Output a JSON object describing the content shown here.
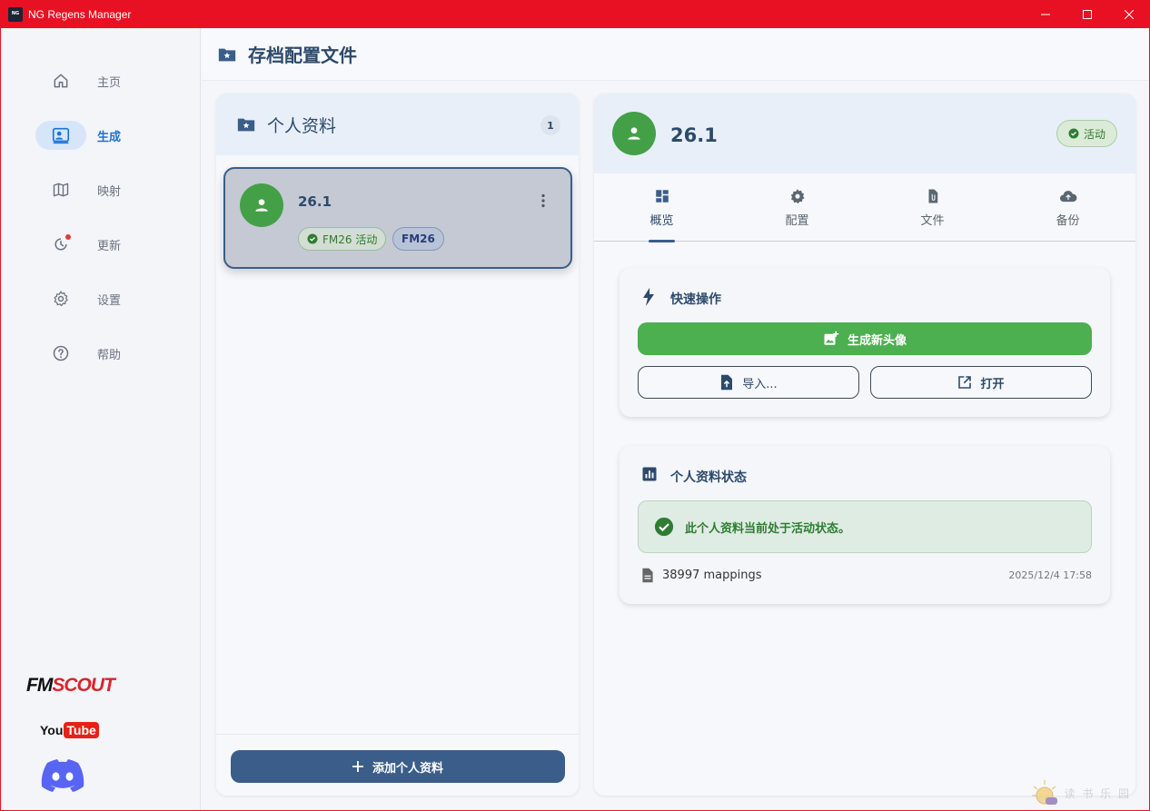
{
  "window": {
    "logo_text": "NG",
    "title": "NG Regens Manager"
  },
  "sidebar": {
    "items": [
      {
        "label": "主页",
        "icon": "home-icon",
        "active": false
      },
      {
        "label": "生成",
        "icon": "account-box-icon",
        "active": true
      },
      {
        "label": "映射",
        "icon": "map-icon",
        "active": false
      },
      {
        "label": "更新",
        "icon": "update-icon",
        "active": false,
        "notification": true
      },
      {
        "label": "设置",
        "icon": "gear-icon",
        "active": false
      },
      {
        "label": "帮助",
        "icon": "help-icon",
        "active": false
      }
    ],
    "brands": {
      "fmscout_fm": "FM",
      "fmscout_scout": "SCOUT",
      "youtube_you": "You",
      "youtube_tube": "Tube"
    }
  },
  "header": {
    "title": "存档配置文件"
  },
  "profiles_panel": {
    "title": "个人资料",
    "count": "1",
    "profiles": [
      {
        "name": "26.1",
        "active_chip": "FM26 活动",
        "version_chip": "FM26"
      }
    ],
    "add_button": "添加个人资料"
  },
  "detail": {
    "name": "26.1",
    "status": "活动",
    "tabs": [
      {
        "label": "概览",
        "icon": "dashboard-icon",
        "active": true
      },
      {
        "label": "配置",
        "icon": "gear-icon",
        "active": false
      },
      {
        "label": "文件",
        "icon": "file-attachment-icon",
        "active": false
      },
      {
        "label": "备份",
        "icon": "cloud-upload-icon",
        "active": false
      }
    ],
    "quick_actions": {
      "title": "快速操作",
      "generate": "生成新头像",
      "import": "导入...",
      "open": "打开"
    },
    "status_card": {
      "title": "个人资料状态",
      "message": "此个人资料当前处于活动状态。",
      "mappings": "38997 mappings",
      "date": "2025/12/4 17:58"
    }
  },
  "watermark": {
    "text": "读 书 乐 园"
  },
  "colors": {
    "titlebar": "#e81123",
    "primary": "#3a5e89",
    "success": "#4caf50",
    "accent_blue": "#1a73d9"
  }
}
